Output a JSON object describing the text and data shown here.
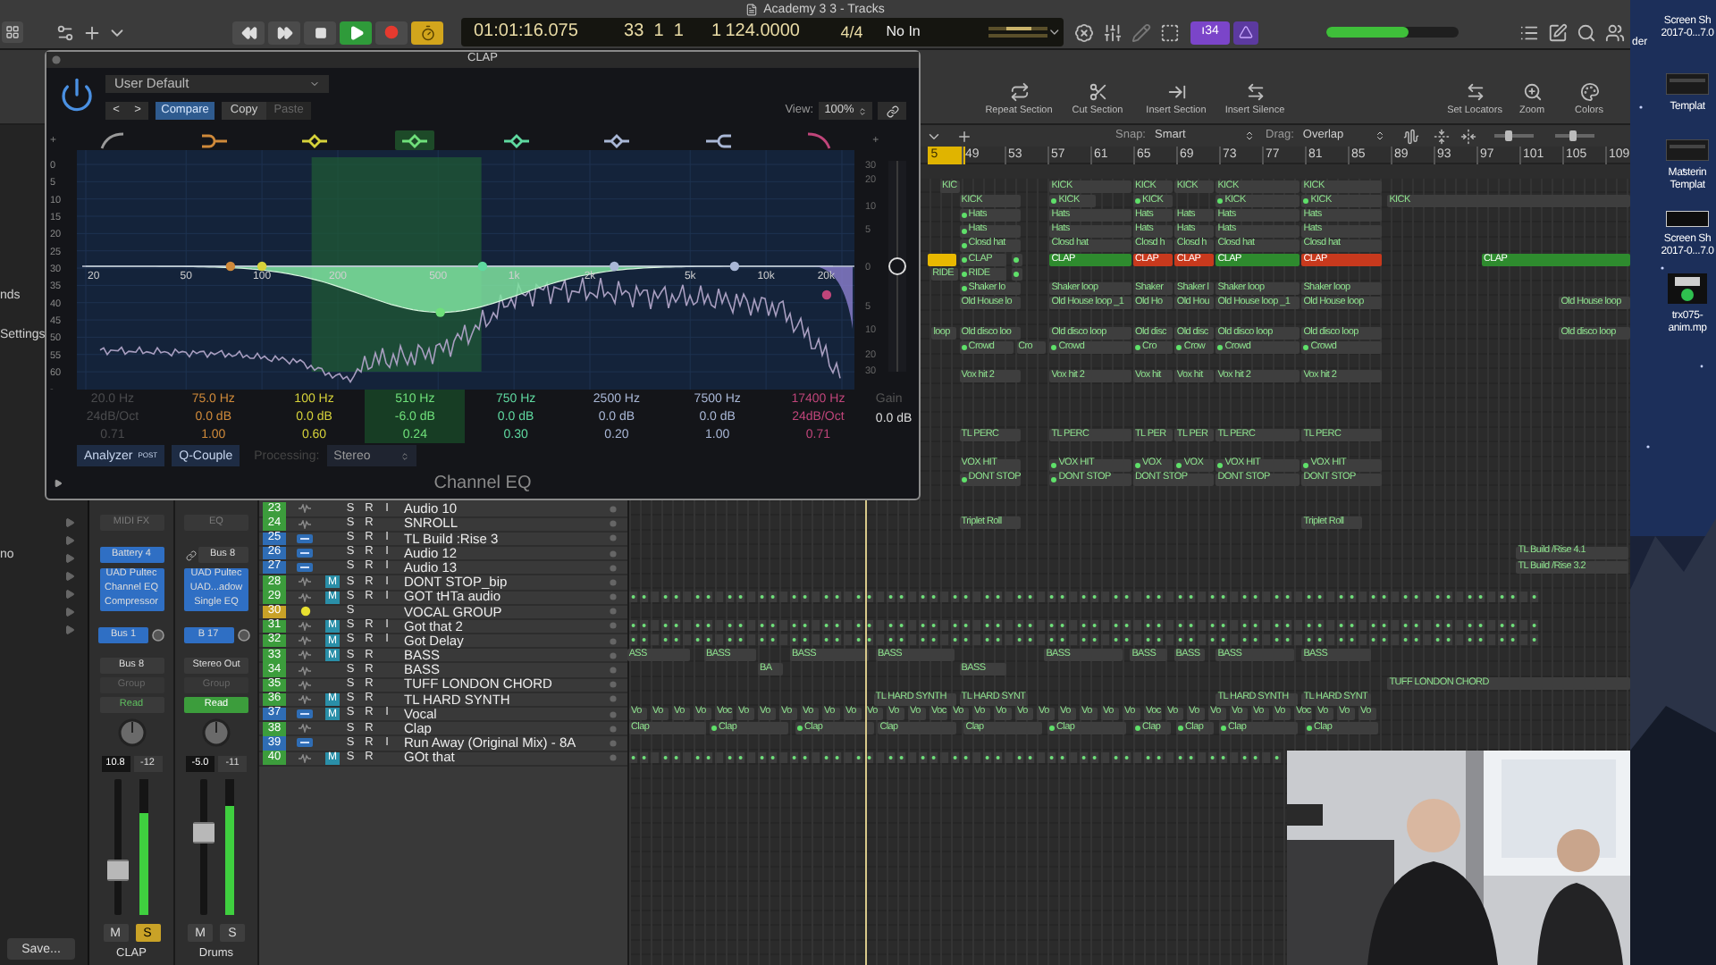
{
  "window": {
    "title": "Academy 3 3 - Tracks"
  },
  "lcd": {
    "time": "01:01:16.075",
    "position": "33  1  1",
    "division": "1",
    "tempo": "124.0000",
    "signature": "4/4",
    "input": "No In"
  },
  "toolbar": {
    "badge": "ı34",
    "volume": {
      "level": 0.62
    }
  },
  "section_tools": [
    {
      "label": "Repeat Section"
    },
    {
      "label": "Cut Section"
    },
    {
      "label": "Insert Section"
    },
    {
      "label": "Insert Silence"
    }
  ],
  "view_tools": [
    {
      "label": "Set Locators"
    },
    {
      "label": "Zoom"
    },
    {
      "label": "Colors"
    }
  ],
  "arrange_toolbar": {
    "snap_label": "Snap:",
    "snap": "Smart",
    "drag_label": "Drag:",
    "drag": "Overlap",
    "vertical_zoom": {
      "level": 0.35
    },
    "horizontal_zoom": {
      "level": 0.45
    }
  },
  "ruler": [
    {
      "label": "5",
      "kind": "cycle"
    },
    {
      "label": "49",
      "kind": "bar"
    },
    {
      "label": "53",
      "kind": "bar"
    },
    {
      "label": "57",
      "kind": "bar"
    },
    {
      "label": "61",
      "kind": "bar"
    },
    {
      "label": "65",
      "kind": "bar"
    },
    {
      "label": "69",
      "kind": "bar"
    },
    {
      "label": "73",
      "kind": "bar"
    },
    {
      "label": "77",
      "kind": "bar"
    },
    {
      "label": "81",
      "kind": "bar"
    },
    {
      "label": "85",
      "kind": "bar"
    },
    {
      "label": "89",
      "kind": "bar"
    },
    {
      "label": "93",
      "kind": "bar"
    },
    {
      "label": "97",
      "kind": "bar"
    },
    {
      "label": "101",
      "kind": "bar"
    },
    {
      "label": "105",
      "kind": "bar"
    },
    {
      "label": "109",
      "kind": "bar"
    }
  ],
  "inspector": {
    "labels": [
      "nds",
      "Settings",
      "no"
    ],
    "save": "Save..."
  },
  "channel_strips": [
    {
      "name": "CLAP",
      "header": "MIDI FX",
      "input": {
        "label": "Battery 4",
        "linked": false
      },
      "inserts": [
        "UAD Pultec",
        "Channel EQ",
        "Compressor"
      ],
      "send": "Bus 1",
      "output": "Bus 8",
      "group": "Group",
      "automation": {
        "label": "Read",
        "on": false
      },
      "volume": "10.8",
      "peak": "-12",
      "fader": {
        "level": 0.3
      },
      "meter": {
        "level": 0.75
      },
      "mute": {
        "label": "M",
        "on": false
      },
      "solo": {
        "label": "S",
        "on": true
      }
    },
    {
      "name": "Drums",
      "header": "EQ",
      "input": {
        "label": "Bus 8",
        "linked": true
      },
      "inserts": [
        "UAD Pultec",
        "UAD...adow",
        "Single EQ"
      ],
      "send": "B 17",
      "output": "Stereo Out",
      "group": "Group",
      "automation": {
        "label": "Read",
        "on": true
      },
      "volume": "-5.0",
      "peak": "-11",
      "fader": {
        "level": 0.62
      },
      "meter": {
        "level": 0.8
      },
      "mute": {
        "label": "M",
        "on": false
      },
      "solo": {
        "label": "S",
        "on": false
      }
    }
  ],
  "tracks": [
    {
      "number": "23",
      "color": "#3c9d3c",
      "kind": "audio",
      "buttons": [
        "S",
        "R",
        "I"
      ],
      "name": "Audio 10"
    },
    {
      "number": "24",
      "color": "#3c9d3c",
      "kind": "audio",
      "buttons": [
        "S",
        "R"
      ],
      "name": "SNROLL"
    },
    {
      "number": "25",
      "color": "#2f6db5",
      "kind": "instrument",
      "buttons": [
        "S",
        "R",
        "I"
      ],
      "name": "TL Build :Rise 3"
    },
    {
      "number": "26",
      "color": "#2f6db5",
      "kind": "instrument",
      "buttons": [
        "S",
        "R",
        "I"
      ],
      "name": "Audio 12"
    },
    {
      "number": "27",
      "color": "#2f6db5",
      "kind": "instrument",
      "buttons": [
        "S",
        "R",
        "I"
      ],
      "name": "Audio 13"
    },
    {
      "number": "28",
      "color": "#3c9d3c",
      "kind": "audio",
      "mute": "M",
      "buttons": [
        "S",
        "R",
        "I"
      ],
      "name": "DONT STOP_bip"
    },
    {
      "number": "29",
      "color": "#3c9d3c",
      "kind": "audio",
      "mute": "M",
      "buttons": [
        "S",
        "R",
        "I"
      ],
      "name": "GOT tHTa audio"
    },
    {
      "number": "30",
      "color": "#c9a227",
      "kind": "summing",
      "buttons": [
        "S"
      ],
      "name": "VOCAL GROUP"
    },
    {
      "number": "31",
      "color": "#3c9d3c",
      "kind": "audio",
      "mute": "M",
      "buttons": [
        "S",
        "R",
        "I"
      ],
      "name": "Got that 2"
    },
    {
      "number": "32",
      "color": "#3c9d3c",
      "kind": "audio",
      "mute": "M",
      "buttons": [
        "S",
        "R",
        "I"
      ],
      "name": "Got Delay"
    },
    {
      "number": "33",
      "color": "#3c9d3c",
      "kind": "audio",
      "mute": "M",
      "buttons": [
        "S",
        "R"
      ],
      "name": "BASS"
    },
    {
      "number": "34",
      "color": "#3c9d3c",
      "kind": "audio",
      "buttons": [
        "S",
        "R"
      ],
      "name": "BASS"
    },
    {
      "number": "35",
      "color": "#3c9d3c",
      "kind": "audio",
      "buttons": [
        "S",
        "R"
      ],
      "name": "TUFF LONDON CHORD"
    },
    {
      "number": "36",
      "color": "#3c9d3c",
      "kind": "audio",
      "mute": "M",
      "buttons": [
        "S",
        "R"
      ],
      "name": "TL HARD SYNTH"
    },
    {
      "number": "37",
      "color": "#2f6db5",
      "kind": "instrument",
      "mute": "M",
      "buttons": [
        "S",
        "R",
        "I"
      ],
      "name": "Vocal"
    },
    {
      "number": "38",
      "color": "#3c9d3c",
      "kind": "audio",
      "buttons": [
        "S",
        "R"
      ],
      "name": "Clap"
    },
    {
      "number": "39",
      "color": "#2f6db5",
      "kind": "instrument",
      "buttons": [
        "S",
        "R",
        "I"
      ],
      "name": "Run Away (Original Mix) - 8A"
    },
    {
      "number": "40",
      "color": "#3c9d3c",
      "kind": "audio",
      "mute": "M",
      "buttons": [
        "S",
        "R"
      ],
      "name": "GOt that"
    }
  ],
  "lanes": [
    {
      "kind": "regions",
      "regions": [
        {
          "label": "KIC",
          "dot": false
        },
        {
          "label": "KICK",
          "dot": false
        },
        {
          "label": "KICK",
          "dot": false
        },
        {
          "label": "KICK",
          "dot": false
        },
        {
          "label": "KICK",
          "dot": false
        },
        {
          "label": "KICK",
          "dot": false
        }
      ]
    },
    {
      "kind": "regions",
      "regions": [
        {
          "label": "KICK",
          "dot": false
        },
        {
          "label": "KICK",
          "dot": true
        },
        {
          "label": "KICK",
          "dot": true
        },
        {
          "label": "KICK",
          "dot": true
        },
        {
          "label": "KICK",
          "dot": true
        },
        {
          "label": "KICK",
          "dot": false
        }
      ]
    },
    {
      "kind": "regions",
      "regions": [
        {
          "label": "Hats",
          "dot": true
        },
        {
          "label": "Hats",
          "dot": false
        },
        {
          "label": "Hats",
          "dot": false
        },
        {
          "label": "Hats",
          "dot": false
        },
        {
          "label": "Hats",
          "dot": false
        },
        {
          "label": "Hats",
          "dot": false
        }
      ]
    },
    {
      "kind": "regions",
      "regions": [
        {
          "label": "Hats",
          "dot": true
        },
        {
          "label": "Hats",
          "dot": false
        },
        {
          "label": "Hats",
          "dot": false
        },
        {
          "label": "Hats",
          "dot": false
        },
        {
          "label": "Hats",
          "dot": false
        },
        {
          "label": "Hats",
          "dot": false
        }
      ]
    },
    {
      "kind": "regions",
      "regions": [
        {
          "label": "Closd hat",
          "dot": true
        },
        {
          "label": "Closd hat",
          "dot": false
        },
        {
          "label": "Closd h",
          "dot": false
        },
        {
          "label": "Closd h",
          "dot": false
        },
        {
          "label": "Closd hat",
          "dot": false
        },
        {
          "label": "Closd hat",
          "dot": false
        }
      ]
    },
    {
      "kind": "regions",
      "regions": [
        {
          "dot": false,
          "color": "#e8b800"
        },
        {
          "label": "CLAP",
          "dot": true
        },
        {
          "dot": true
        },
        {
          "label": "CLAP",
          "dot": false,
          "color": "#2e8b2e"
        },
        {
          "label": "CLAP",
          "dot": false,
          "color": "#c8391d"
        },
        {
          "label": "CLAP",
          "dot": false,
          "color": "#c8391d"
        },
        {
          "label": "CLAP",
          "dot": false,
          "color": "#2e8b2e"
        },
        {
          "label": "CLAP",
          "dot": false,
          "color": "#c8391d"
        },
        {
          "label": "CLAP",
          "dot": false,
          "color": "#2e8b2e"
        }
      ]
    },
    {
      "kind": "regions",
      "regions": [
        {
          "label": "RIDE",
          "dot": false
        },
        {
          "label": "RIDE",
          "dot": true
        },
        {
          "dot": true
        }
      ]
    },
    {
      "kind": "regions",
      "regions": [
        {
          "label": "Shaker lo",
          "dot": true
        },
        {
          "label": "Shaker loop",
          "dot": false
        },
        {
          "label": "Shaker",
          "dot": false
        },
        {
          "label": "Shaker l",
          "dot": false
        },
        {
          "label": "Shaker loop",
          "dot": false
        },
        {
          "label": "Shaker loop",
          "dot": false
        }
      ]
    },
    {
      "kind": "regions",
      "regions": [
        {
          "label": "Old House lo",
          "dot": false
        },
        {
          "label": "Old House loop _1",
          "dot": false
        },
        {
          "label": "Old Ho",
          "dot": false
        },
        {
          "label": "Old Hou",
          "dot": false
        },
        {
          "label": "Old House loop _1",
          "dot": false
        },
        {
          "label": "Old House loop",
          "dot": false
        },
        {
          "label": "Old House loop",
          "dot": false
        }
      ]
    },
    {
      "kind": "empty"
    },
    {
      "kind": "regions",
      "regions": [
        {
          "label": "loop",
          "dot": false
        },
        {
          "label": "Old disco  loo",
          "dot": false
        },
        {
          "label": "Old disco  loop",
          "dot": false
        },
        {
          "label": "Old disc",
          "dot": false
        },
        {
          "label": "Old disc",
          "dot": false
        },
        {
          "label": "Old disco  loop",
          "dot": false
        },
        {
          "label": "Old disco  loop",
          "dot": false
        },
        {
          "label": "Old disco  loop",
          "dot": false
        }
      ]
    },
    {
      "kind": "regions",
      "regions": [
        {
          "label": "Crowd",
          "dot": true
        },
        {
          "label": "Cro",
          "dot": false
        },
        {
          "label": "Crowd",
          "dot": true
        },
        {
          "label": "Cro",
          "dot": true
        },
        {
          "label": "Crow",
          "dot": true
        },
        {
          "label": "Crowd",
          "dot": true
        },
        {
          "label": "Crowd",
          "dot": true
        }
      ]
    },
    {
      "kind": "empty"
    },
    {
      "kind": "regions",
      "regions": [
        {
          "label": "Vox hit 2",
          "dot": false
        },
        {
          "label": "Vox hit 2",
          "dot": false
        },
        {
          "label": "Vox hit",
          "dot": false
        },
        {
          "label": "Vox hit",
          "dot": false
        },
        {
          "label": "Vox hit 2",
          "dot": false
        },
        {
          "label": "Vox hit 2",
          "dot": false
        }
      ]
    },
    {
      "kind": "empty"
    },
    {
      "kind": "empty"
    },
    {
      "kind": "empty"
    },
    {
      "kind": "regions",
      "regions": [
        {
          "label": "TL PERC",
          "dot": false
        },
        {
          "label": "TL PERC",
          "dot": false
        },
        {
          "label": "TL PER",
          "dot": false
        },
        {
          "label": "TL PER",
          "dot": false
        },
        {
          "label": "TL PERC",
          "dot": false
        },
        {
          "label": "TL PERC",
          "dot": false
        }
      ]
    },
    {
      "kind": "empty"
    },
    {
      "kind": "regions",
      "regions": [
        {
          "label": "VOX HIT",
          "dot": false
        },
        {
          "label": "VOX HIT",
          "dot": true
        },
        {
          "label": "VOX",
          "dot": true
        },
        {
          "label": "VOX",
          "dot": true
        },
        {
          "label": "VOX HIT",
          "dot": true
        },
        {
          "label": "VOX HIT",
          "dot": true
        }
      ]
    },
    {
      "kind": "regions",
      "regions": [
        {
          "label": "DONT STOP",
          "dot": true
        },
        {
          "label": "DONT STOP",
          "dot": true
        },
        {
          "label": "DONT STOP",
          "dot": false
        },
        {
          "label": "DONT STOP",
          "dot": false
        },
        {
          "label": "DONT STOP",
          "dot": false
        }
      ]
    },
    {
      "kind": "empty"
    },
    {
      "kind": "empty"
    },
    {
      "kind": "regions",
      "regions": [
        {
          "label": "Triplet Roll",
          "dot": false
        },
        {
          "label": "Triplet Roll",
          "dot": false
        }
      ]
    },
    {
      "kind": "empty"
    },
    {
      "kind": "regions",
      "regions": [
        {
          "label": "TL Build /Rise 4.1",
          "dot": false
        }
      ]
    },
    {
      "kind": "regions",
      "regions": [
        {
          "label": "TL Build /Rise 3.2",
          "dot": false
        }
      ]
    },
    {
      "kind": "empty"
    },
    {
      "kind": "pattern"
    },
    {
      "kind": "empty"
    },
    {
      "kind": "pattern"
    },
    {
      "kind": "pattern"
    },
    {
      "kind": "regions",
      "regions": [
        {
          "label": "ASS",
          "dot": false
        },
        {
          "label": "BASS",
          "dot": false
        },
        {
          "label": "BASS",
          "dot": false
        },
        {
          "label": "BASS",
          "dot": false
        },
        {
          "label": "BASS",
          "dot": false
        },
        {
          "label": "BASS",
          "dot": false
        },
        {
          "label": "BASS",
          "dot": false
        },
        {
          "label": "BASS",
          "dot": false
        },
        {
          "label": "BASS",
          "dot": false
        }
      ]
    },
    {
      "kind": "regions",
      "regions": [
        {
          "label": "BA",
          "dot": false
        },
        {
          "label": "BASS",
          "dot": false
        }
      ]
    },
    {
      "kind": "regions",
      "regions": [
        {
          "label": "TUFF LONDON CHORD",
          "dot": false
        }
      ]
    },
    {
      "kind": "regions",
      "regions": [
        {
          "label": "TL HARD SYNTH",
          "dot": false
        },
        {
          "label": "TL HARD SYNT",
          "dot": false
        },
        {
          "label": "TL HARD SYNTH",
          "dot": false
        },
        {
          "label": "TL HARD SYNT",
          "dot": false
        }
      ]
    },
    {
      "kind": "regions",
      "regions": [
        {
          "label": "Vo",
          "dot": false
        },
        {
          "label": "Vo",
          "dot": false
        },
        {
          "label": "Vo",
          "dot": false
        },
        {
          "label": "Vo",
          "dot": false
        },
        {
          "label": "Voc",
          "dot": false
        },
        {
          "label": "Vo",
          "dot": false
        },
        {
          "label": "Vo",
          "dot": false
        },
        {
          "label": "Vo",
          "dot": false
        },
        {
          "label": "Vo",
          "dot": false
        },
        {
          "label": "Vo",
          "dot": false
        },
        {
          "label": "Vo",
          "dot": false
        },
        {
          "label": "Vo",
          "dot": false
        },
        {
          "label": "Vo",
          "dot": false
        },
        {
          "label": "Vo",
          "dot": false
        },
        {
          "label": "Voc",
          "dot": false
        },
        {
          "label": "Vo",
          "dot": false
        },
        {
          "label": "Vo",
          "dot": false
        },
        {
          "label": "Vo",
          "dot": false
        },
        {
          "label": "Vo",
          "dot": false
        },
        {
          "label": "Vo",
          "dot": false
        },
        {
          "label": "Vo",
          "dot": false
        },
        {
          "label": "Vo",
          "dot": false
        },
        {
          "label": "Vo",
          "dot": false
        },
        {
          "label": "Vo",
          "dot": false
        },
        {
          "label": "Voc",
          "dot": false
        },
        {
          "label": "Vo",
          "dot": false
        },
        {
          "label": "Vo",
          "dot": false
        },
        {
          "label": "Vo",
          "dot": false
        },
        {
          "label": "Vo",
          "dot": false
        },
        {
          "label": "Vo",
          "dot": false
        },
        {
          "label": "Vo",
          "dot": false
        },
        {
          "label": "Voc",
          "dot": false
        },
        {
          "label": "Vo",
          "dot": false
        },
        {
          "label": "Vo",
          "dot": false
        },
        {
          "label": "Vo",
          "dot": false
        }
      ]
    },
    {
      "kind": "regions",
      "regions": [
        {
          "label": "Clap",
          "dot": false
        },
        {
          "label": "Clap",
          "dot": true
        },
        {
          "label": "Clap",
          "dot": true
        },
        {
          "label": "Clap",
          "dot": false
        },
        {
          "label": "Clap",
          "dot": false
        },
        {
          "label": "Clap",
          "dot": true
        },
        {
          "label": "Clap",
          "dot": true
        },
        {
          "label": "Clap",
          "dot": true
        },
        {
          "label": "Clap",
          "dot": true
        },
        {
          "label": "Clap",
          "dot": true
        }
      ]
    },
    {
      "kind": "empty"
    },
    {
      "kind": "pattern"
    }
  ],
  "plugin": {
    "title": "CLAP",
    "preset": "User Default",
    "prev": "<",
    "next": ">",
    "compare": "Compare",
    "copy": "Copy",
    "paste": "Paste",
    "view_label": "View:",
    "view": "100%",
    "top_marks": [
      "+",
      "+"
    ],
    "db_scale": [
      "0",
      "5",
      "10",
      "15",
      "20",
      "25",
      "30",
      "35",
      "40",
      "45",
      "50",
      "55",
      "60",
      "-"
    ],
    "gain_scale": [
      "30",
      "20",
      "10",
      "5",
      "0",
      "5",
      "10",
      "20",
      "30"
    ],
    "frequencies": [
      "20",
      "50",
      "100",
      "200",
      "500",
      "1k",
      "2k",
      "5k",
      "10k",
      "20k"
    ],
    "bands": [
      {
        "kind": "lowcut",
        "color": "#9a9a9a",
        "on": false,
        "selected": false,
        "frequency": "20.0 Hz",
        "gain": "24dB/Oct",
        "q": "0.71"
      },
      {
        "kind": "lowshelf",
        "color": "#d08a3a",
        "on": true,
        "selected": false,
        "frequency": "75.0 Hz",
        "gain": "0.0 dB",
        "q": "1.00"
      },
      {
        "kind": "bell",
        "color": "#d6d23a",
        "on": true,
        "selected": false,
        "frequency": "100 Hz",
        "gain": "0.0 dB",
        "q": "0.60"
      },
      {
        "kind": "bell",
        "color": "#6fe07a",
        "on": true,
        "selected": true,
        "frequency": "510 Hz",
        "gain": "-6.0 dB",
        "q": "0.24"
      },
      {
        "kind": "bell",
        "color": "#5fd9a0",
        "on": true,
        "selected": false,
        "frequency": "750 Hz",
        "gain": "0.0 dB",
        "q": "0.30"
      },
      {
        "kind": "bell",
        "color": "#a9b7d6",
        "on": true,
        "selected": false,
        "frequency": "2500 Hz",
        "gain": "0.0 dB",
        "q": "0.20"
      },
      {
        "kind": "highshelf",
        "color": "#a9b7d6",
        "on": true,
        "selected": false,
        "frequency": "7500 Hz",
        "gain": "0.0 dB",
        "q": "1.00"
      },
      {
        "kind": "highcut",
        "color": "#c0457a",
        "on": true,
        "selected": false,
        "frequency": "17400 Hz",
        "gain": "24dB/Oct",
        "q": "0.71"
      }
    ],
    "gain_label": "Gain",
    "gain": "0.0 dB",
    "gain_slider": {
      "level": 0.5
    },
    "analyzer": "Analyzer",
    "analyzer_mode": "POST",
    "q_couple": "Q-Couple",
    "processing_label": "Processing:",
    "processing": "Stereo",
    "name": "Channel EQ"
  },
  "desktop": {
    "partial": "der",
    "files": [
      {
        "kind": "cut",
        "lines": [
          "Screen Sh",
          "2017-0...7.0"
        ]
      },
      {
        "kind": "template",
        "lines": [
          "Templat"
        ]
      },
      {
        "kind": "template",
        "lines": [
          "Masterin",
          "Templat"
        ]
      },
      {
        "kind": "screenshot",
        "lines": [
          "Screen Sh",
          "2017-0...7.0"
        ]
      },
      {
        "kind": "video",
        "lines": [
          "trx075-",
          "anim.mp"
        ]
      }
    ]
  }
}
